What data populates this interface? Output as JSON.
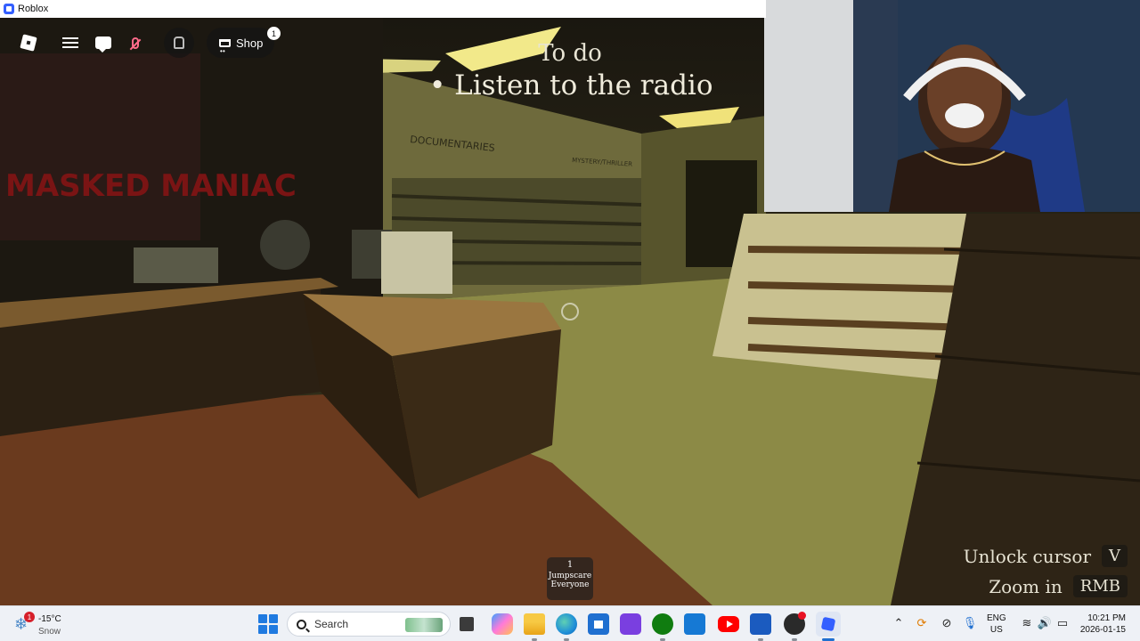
{
  "window": {
    "title": "Roblox"
  },
  "hud": {
    "shop_label": "Shop",
    "shop_badge": "1"
  },
  "objective": {
    "title": "To do",
    "item": "• Listen to the radio"
  },
  "scene_signs": {
    "left": "DOCUMENTARIES",
    "right": "MYSTERY/THRILLER",
    "poster": "MASKED MANIAC"
  },
  "hints": [
    {
      "label": "Unlock cursor",
      "key": "V"
    },
    {
      "label": "Zoom in",
      "key": "RMB"
    }
  ],
  "hotbar": {
    "slot_number": "1",
    "slot_label": "Jumpscare Everyone"
  },
  "taskbar": {
    "weather": {
      "temp": "-15°C",
      "condition": "Snow",
      "badge": "1",
      "icon": "snow-icon"
    },
    "search_placeholder": "Search",
    "lang": {
      "line1": "ENG",
      "line2": "US"
    },
    "clock": {
      "time": "10:21 PM",
      "date": "2026-01-15"
    },
    "pinned_icons": [
      "task-view-icon",
      "copilot-icon",
      "file-explorer-icon",
      "edge-icon",
      "ms-store-icon",
      "proton-icon",
      "xbox-icon",
      "outlook-icon",
      "youtube-icon",
      "word-icon",
      "obs-icon",
      "roblox-icon"
    ]
  },
  "colors": {
    "roblox_blue": "#335fff",
    "taskbar_bg": "#eef1f6",
    "mic_muted": "#ff6b8a"
  }
}
